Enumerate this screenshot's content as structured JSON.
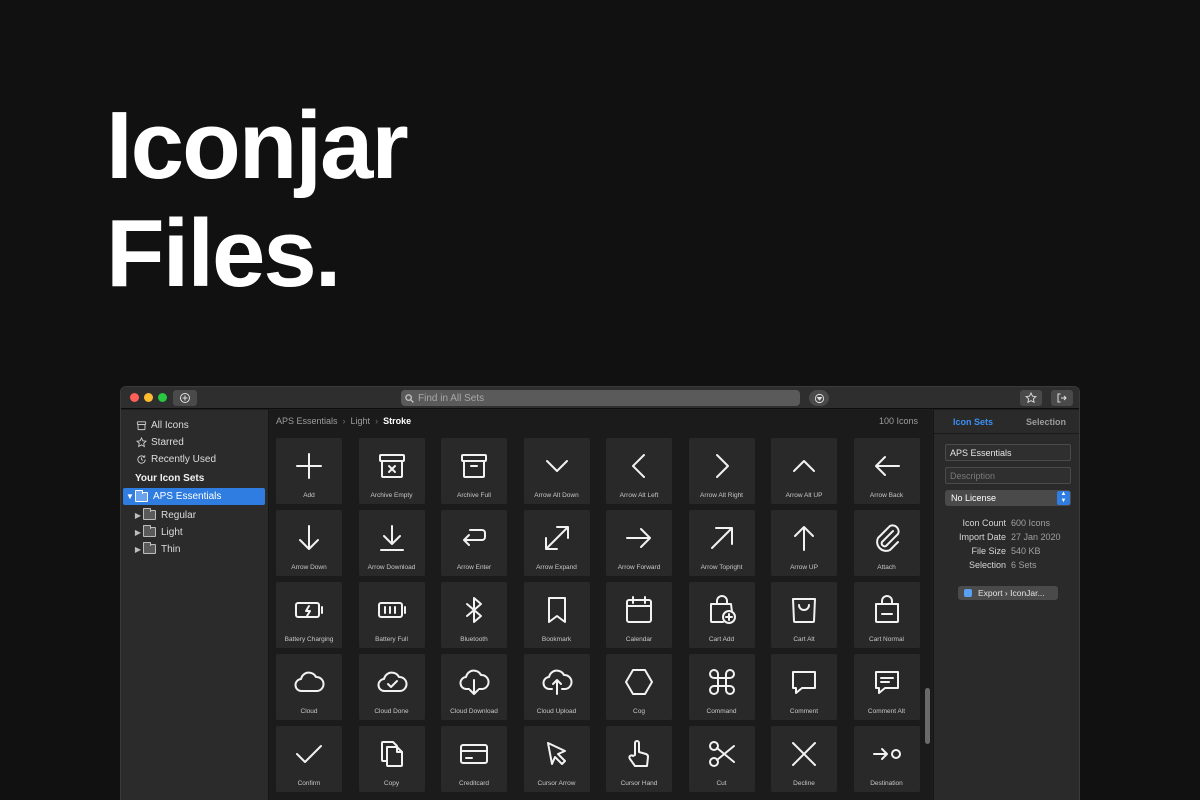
{
  "hero": {
    "line1": "Iconjar",
    "line2": "Files."
  },
  "toolbar": {
    "search_placeholder": "Find in All Sets"
  },
  "sidebar": {
    "items": [
      {
        "label": "All Icons",
        "icon": "archive-icon"
      },
      {
        "label": "Starred",
        "icon": "star-icon"
      },
      {
        "label": "Recently Used",
        "icon": "clock-icon"
      }
    ],
    "sets_header": "Your Icon Sets",
    "selected_set": "APS Essentials",
    "children": [
      {
        "label": "Regular"
      },
      {
        "label": "Light"
      },
      {
        "label": "Thin"
      }
    ]
  },
  "main": {
    "breadcrumb": [
      "APS Essentials",
      "Light",
      "Stroke"
    ],
    "icon_count": "100 Icons",
    "icons": [
      {
        "label": "Add",
        "icon": "add"
      },
      {
        "label": "Archive Empty",
        "icon": "archive-empty"
      },
      {
        "label": "Archive Full",
        "icon": "archive-full"
      },
      {
        "label": "Arrow Alt Down",
        "icon": "chev-down"
      },
      {
        "label": "Arrow Alt Left",
        "icon": "chev-left"
      },
      {
        "label": "Arrow Alt Right",
        "icon": "chev-right"
      },
      {
        "label": "Arrow Alt UP",
        "icon": "chev-up"
      },
      {
        "label": "Arrow Back",
        "icon": "arrow-back"
      },
      {
        "label": "Arrow Down",
        "icon": "arrow-down"
      },
      {
        "label": "Arrow Download",
        "icon": "download"
      },
      {
        "label": "Arrow Enter",
        "icon": "enter"
      },
      {
        "label": "Arrow Expand",
        "icon": "expand"
      },
      {
        "label": "Arrow Forward",
        "icon": "arrow-forward"
      },
      {
        "label": "Arrow Topright",
        "icon": "arrow-topright"
      },
      {
        "label": "Arrow UP",
        "icon": "arrow-up"
      },
      {
        "label": "Attach",
        "icon": "attach"
      },
      {
        "label": "Battery Charging",
        "icon": "battery-charging"
      },
      {
        "label": "Battery Full",
        "icon": "battery-full"
      },
      {
        "label": "Bluetooth",
        "icon": "bluetooth"
      },
      {
        "label": "Bookmark",
        "icon": "bookmark"
      },
      {
        "label": "Calendar",
        "icon": "calendar"
      },
      {
        "label": "Cart Add",
        "icon": "cart-add"
      },
      {
        "label": "Cart Alt",
        "icon": "cart-alt"
      },
      {
        "label": "Cart Normal",
        "icon": "cart-normal"
      },
      {
        "label": "Cloud",
        "icon": "cloud"
      },
      {
        "label": "Cloud Done",
        "icon": "cloud-done"
      },
      {
        "label": "Cloud Download",
        "icon": "cloud-download"
      },
      {
        "label": "Cloud Upload",
        "icon": "cloud-upload"
      },
      {
        "label": "Cog",
        "icon": "cog"
      },
      {
        "label": "Command",
        "icon": "command"
      },
      {
        "label": "Comment",
        "icon": "comment"
      },
      {
        "label": "Comment Alt",
        "icon": "comment-alt"
      },
      {
        "label": "Confirm",
        "icon": "confirm"
      },
      {
        "label": "Copy",
        "icon": "copy"
      },
      {
        "label": "Creditcard",
        "icon": "creditcard"
      },
      {
        "label": "Cursor Arrow",
        "icon": "cursor-arrow"
      },
      {
        "label": "Cursor Hand",
        "icon": "cursor-hand"
      },
      {
        "label": "Cut",
        "icon": "cut"
      },
      {
        "label": "Decline",
        "icon": "decline"
      },
      {
        "label": "Destination",
        "icon": "destination"
      }
    ]
  },
  "inspector": {
    "tabs": [
      "Icon Sets",
      "Selection"
    ],
    "name_value": "APS Essentials",
    "description_placeholder": "Description",
    "license": "No License",
    "meta": [
      {
        "key": "Icon Count",
        "value": "600 Icons"
      },
      {
        "key": "Import Date",
        "value": "27 Jan 2020"
      },
      {
        "key": "File Size",
        "value": "540 KB"
      },
      {
        "key": "Selection",
        "value": "6 Sets"
      }
    ],
    "export_label": "Export › IconJar..."
  },
  "colors": {
    "accent": "#2f7de1",
    "tab_active": "#3b8ff3",
    "background": "#111111"
  }
}
